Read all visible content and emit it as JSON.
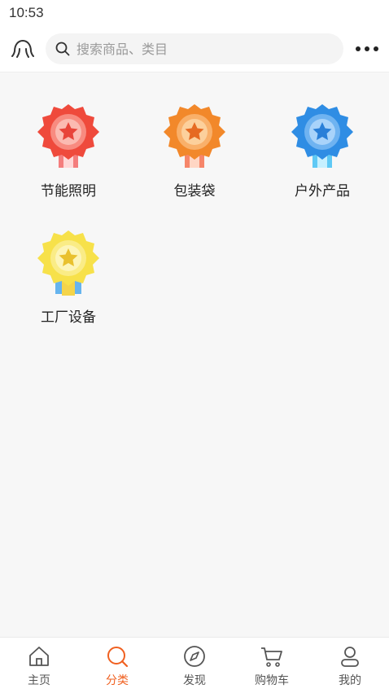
{
  "status_bar": {
    "time": "10:53"
  },
  "header": {
    "logo_icon": "octopus-icon",
    "search_placeholder": "搜索商品、类目",
    "more_icon": "more-dots-icon"
  },
  "categories": [
    {
      "label": "节能照明",
      "icon": "red-badge-icon",
      "color": "#f04a3c"
    },
    {
      "label": "包装袋",
      "icon": "orange-badge-icon",
      "color": "#f2882a"
    },
    {
      "label": "户外产品",
      "icon": "blue-badge-icon",
      "color": "#2f8de4"
    },
    {
      "label": "工厂设备",
      "icon": "yellow-badge-icon",
      "color": "#f7e14a"
    }
  ],
  "tabbar": {
    "active_color": "#f06020",
    "items": [
      {
        "label": "主页",
        "icon": "home-icon"
      },
      {
        "label": "分类",
        "icon": "category-search-icon",
        "active": true
      },
      {
        "label": "发现",
        "icon": "compass-icon"
      },
      {
        "label": "购物车",
        "icon": "cart-icon"
      },
      {
        "label": "我的",
        "icon": "user-icon"
      }
    ]
  }
}
